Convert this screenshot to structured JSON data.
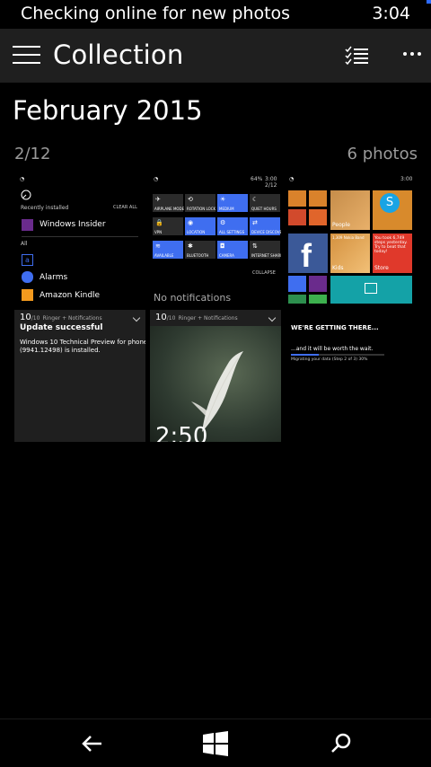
{
  "status": {
    "message": "Checking online for new photos",
    "time": "3:04"
  },
  "appbar": {
    "title": "Collection",
    "select_icon": "select-list-icon",
    "more_icon": "more-dots-icon",
    "menu_icon": "hamburger-icon"
  },
  "section": {
    "month": "February 2015",
    "count": "2/12",
    "photos": "6 photos"
  },
  "thumb1": {
    "recently": "Recently installed",
    "clear": "CLEAR ALL",
    "app1": "Windows Insider",
    "all": "All",
    "letter": "a",
    "app2": "Alarms",
    "app3": "Amazon Kindle"
  },
  "thumb2": {
    "battery": "64%",
    "time": "3:00",
    "date": "2/12",
    "tiles": [
      "AIRPLANE MODE",
      "ROTATION LOCK",
      "MEDIUM",
      "QUIET HOURS",
      "VPN",
      "LOCATION",
      "ALL SETTINGS",
      "DEVICE DISCOVERY",
      "AVAILABLE",
      "BLUETOOTH",
      "CAMERA",
      "INTERNET SHARING"
    ],
    "collapse": "COLLAPSE",
    "none": "No notifications"
  },
  "thumb3": {
    "time": "3:00",
    "people": "People",
    "store": "Store",
    "tile_text": "You took 6,749 steps yesterday. Try to beat that today!",
    "kids": "Kids",
    "sub": "1,309 Nokia Band"
  },
  "thumb4": {
    "num": "10",
    "of": "/10",
    "source": "Ringer + Notifications",
    "title": "Update successful",
    "body1": "Windows 10 Technical Preview for phones",
    "body2": "(9941.12498) is installed."
  },
  "thumb5": {
    "num": "10",
    "of": "/10",
    "source": "Ringer + Notifications",
    "clock": "2:50"
  },
  "thumb6": {
    "title": "WE'RE GETTING THERE...",
    "sub": "...and it will be worth the wait.",
    "progress_label": "Migrating your data (Step 2 of 3) 30%",
    "progress": 0.3
  },
  "colors": {
    "accent": "#3f6ef0",
    "appbar": "#1f1f1f",
    "orange": "#f26b22",
    "red": "#e0392b"
  }
}
